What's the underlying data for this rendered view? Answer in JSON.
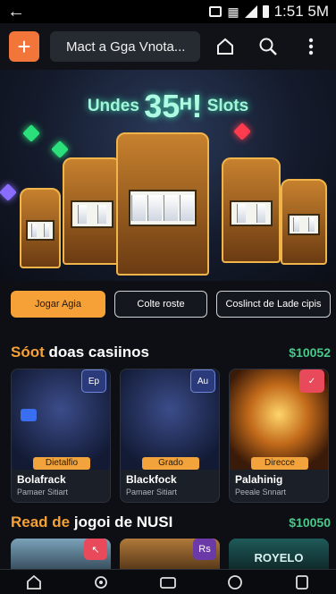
{
  "status_bar": {
    "time": "1:51 5M"
  },
  "top_bar": {
    "search_text": "Mact a Gga Vnota..."
  },
  "hero": {
    "title_left": "Undes",
    "title_big": "35ᵸ!",
    "title_right": "Slots"
  },
  "actions": [
    {
      "label": "Jogar Agia"
    },
    {
      "label": "Colte roste"
    },
    {
      "label": "Coslinct de Lade cipis"
    }
  ],
  "section1": {
    "title_accent": "Sóot",
    "title_rest": " doas casiinos",
    "amount": "$10052"
  },
  "cards": [
    {
      "tag": "Dietalfio",
      "name": "Bolafrack",
      "sub": "Pamaer Sitiart",
      "badge": "Ep"
    },
    {
      "tag": "Grado",
      "name": "Blackfock",
      "sub": "Pamaer Sitiart",
      "badge": "Au"
    },
    {
      "tag": "Direcce",
      "name": "Palahinig",
      "sub": "Peeale Snnart",
      "badge": "✓"
    }
  ],
  "section2": {
    "title_accent": "Read de",
    "title_rest": " jogoi de NUSI",
    "amount": "$10050"
  },
  "mini_cards": [
    {
      "badge": "↖"
    },
    {
      "badge": "Rs"
    },
    {
      "label": "ROYELO"
    }
  ],
  "colors": {
    "accent_orange": "#f5a137",
    "accent_green": "#48c98a",
    "plus_orange": "#f2763a"
  }
}
